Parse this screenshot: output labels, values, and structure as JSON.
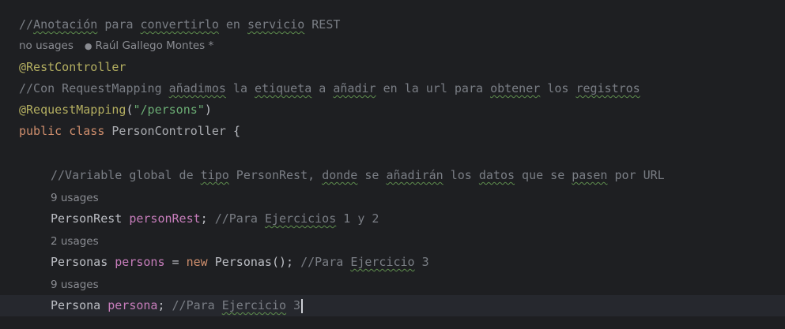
{
  "lines": {
    "l1": {
      "c1": "//",
      "c2": "Anotación",
      "c3": " para ",
      "c4": "convertirlo",
      "c5": " en ",
      "c6": "servicio",
      "c7": " REST"
    },
    "l2": {
      "usages": "no usages",
      "author": "Raúl Gallego Montes *"
    },
    "l3": {
      "annotation": "@RestController"
    },
    "l4": {
      "c1": "//Con RequestMapping ",
      "c2": "añadimos",
      "c3": " la ",
      "c4": "etiqueta",
      "c5": " a ",
      "c6": "añadir",
      "c7": " en la url para ",
      "c8": "obtener",
      "c9": " los ",
      "c10": "registros"
    },
    "l5": {
      "annotation": "@RequestMapping",
      "paren_open": "(",
      "string": "\"/persons\"",
      "paren_close": ")"
    },
    "l6": {
      "kw1": "public",
      "kw2": "class",
      "name": "PersonController",
      "brace": "{"
    },
    "l8": {
      "c1": "//Variable global de ",
      "c2": "tipo",
      "c3": " PersonRest, ",
      "c4": "donde",
      "c5": " se ",
      "c6": "añadirán",
      "c7": " los ",
      "c8": "datos",
      "c9": " que se ",
      "c10": "pasen",
      "c11": " por URL"
    },
    "l9": {
      "usages": "9 usages"
    },
    "l10": {
      "type": "PersonRest",
      "field": "personRest",
      "semi": ";",
      "c1": " //Para ",
      "c2": "Ejercicios",
      "c3": " 1 y 2"
    },
    "l11": {
      "usages": "2 usages"
    },
    "l12": {
      "type": "Personas",
      "field": "persons",
      "op": " = ",
      "kw": "new",
      "ctor": " Personas();",
      "c1": " //Para ",
      "c2": "Ejercicio",
      "c3": " 3"
    },
    "l13": {
      "usages": "9 usages"
    },
    "l14": {
      "type": "Persona",
      "field": "persona",
      "semi": ";",
      "c1": " //Para ",
      "c2": "Ejercicio",
      "c3": " 3"
    }
  },
  "colors": {
    "background": "#1e1f22",
    "current_line": "#26282e",
    "comment": "#7a7e85",
    "annotation": "#b3ae60",
    "keyword": "#cf8e6d",
    "string": "#6aab73",
    "field": "#c77dbb",
    "text": "#bcbec4"
  },
  "icons": {
    "author": "user-icon"
  }
}
